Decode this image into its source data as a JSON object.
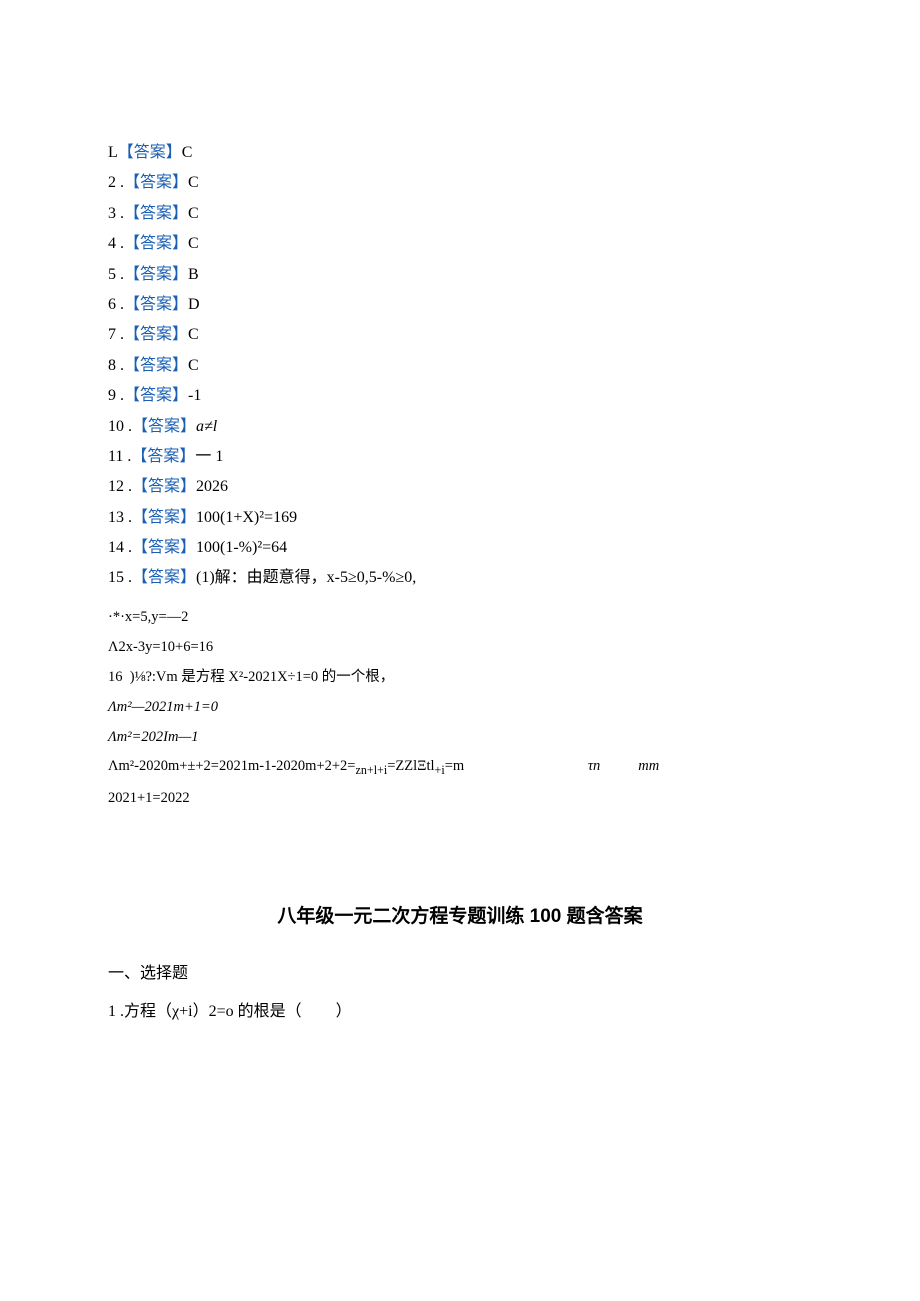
{
  "answer_label": "【答案】",
  "answers": [
    {
      "num": "L",
      "value": "C",
      "first": true
    },
    {
      "num": "2",
      "value": "C"
    },
    {
      "num": "3",
      "value": "C"
    },
    {
      "num": "4",
      "value": "C"
    },
    {
      "num": "5",
      "value": "B"
    },
    {
      "num": "6",
      "value": "D"
    },
    {
      "num": "7",
      "value": "C"
    },
    {
      "num": "8",
      "value": "C"
    },
    {
      "num": "9",
      "value": "-1"
    },
    {
      "num": "10",
      "value": "a≠l",
      "italic": true
    },
    {
      "num": "11",
      "value": "一 1"
    },
    {
      "num": "12",
      "value": "2026"
    },
    {
      "num": "13",
      "value": "100(1+X)²=169"
    },
    {
      "num": "14",
      "value": "100(1-%)²=64"
    }
  ],
  "answer15": {
    "num": "15",
    "prefix": "(1)解：由题意得，x-5≥0,5-%≥0,"
  },
  "work_lines": {
    "l1": "·*·x=5,y=—2",
    "l2": "Λ2x-3y=10+6=16",
    "l3_num": "16",
    "l3_body": ")⅛?:Vm 是方程 X²-2021X÷1=0 的一个根，",
    "l4": "Λm²—2021m+1=0",
    "l5": "Λm²=202Im—1",
    "l6": "Λm²-2020m+±+2=2021m-1-2020m+2+2=",
    "l6_sub": "zn+l+i",
    "l6_mid": "=ZZlΞtl",
    "l6_sub2": "+i",
    "l6_end": "=m",
    "l6_tail_tn": "τn",
    "l6_tail_mm": "mm",
    "l7": "2021+1=2022"
  },
  "section_title": "八年级一元二次方程专题训练 100 题含答案",
  "subsection_label": "一、选择题",
  "question1": {
    "num": "1",
    "body": ".方程（χ+i）2=o 的根是（",
    "close": "）"
  },
  "sep_dot": " ."
}
